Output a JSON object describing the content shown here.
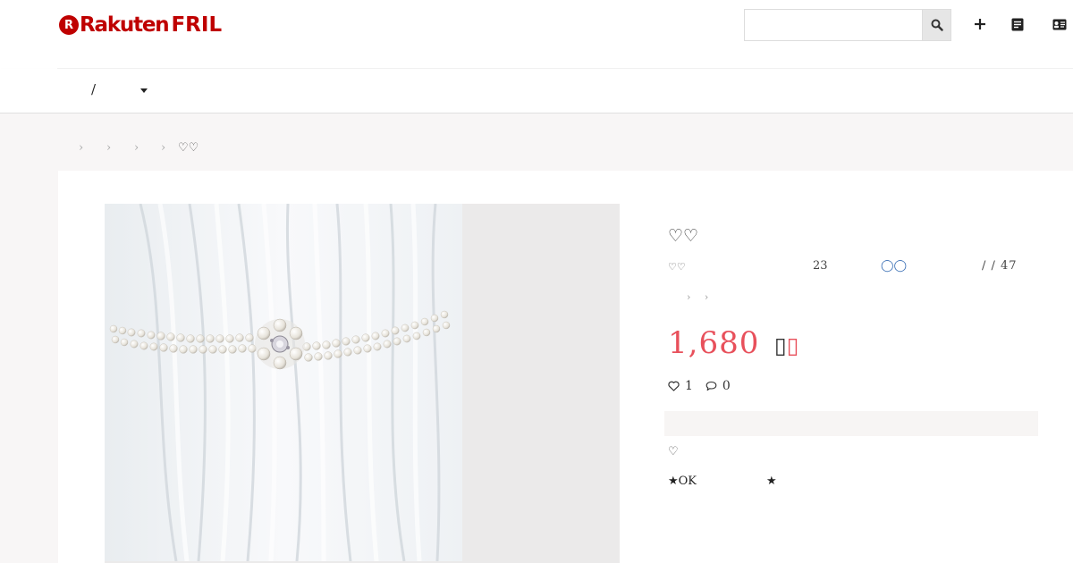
{
  "header": {
    "logo_mark": "R",
    "logo_rakuten": "Rakuten",
    "logo_fril": "FRIL",
    "search_placeholder": "",
    "icons": [
      "search-icon",
      "plus-icon",
      "document-icon",
      "id-card-icon"
    ]
  },
  "nav": {
    "separator": "/",
    "dropdown_icon": "caret-down-icon"
  },
  "breadcrumb": {
    "separators": [
      "›",
      "›",
      "›",
      "›"
    ],
    "current": "♡♡"
  },
  "item": {
    "title": "♡♡",
    "brand_label": "♡♡",
    "count": "23",
    "rating_circles": "◯◯",
    "date": "/ / 47",
    "category_arrows": "› ›",
    "price": "1,680",
    "price_suffix_a": "",
    "price_suffix_b": "",
    "likes": "1",
    "comments": "0",
    "description_heart": "♡",
    "description_ok": "★OK",
    "description_star": "★"
  },
  "colors": {
    "brand_red": "#bf0000",
    "price_red": "#e8505b",
    "page_bg": "#f8f6f6",
    "link_blue": "#3a6fb5"
  }
}
